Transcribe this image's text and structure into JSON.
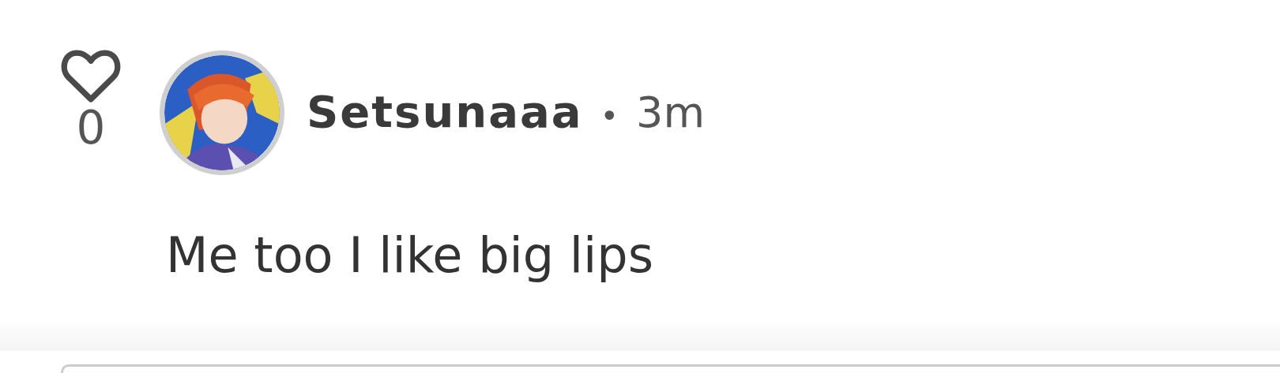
{
  "comment": {
    "liked": false,
    "like_count": "0",
    "author": "Setsunaaa",
    "separator": "•",
    "time": "3m",
    "text": "Me too I like big lips"
  }
}
